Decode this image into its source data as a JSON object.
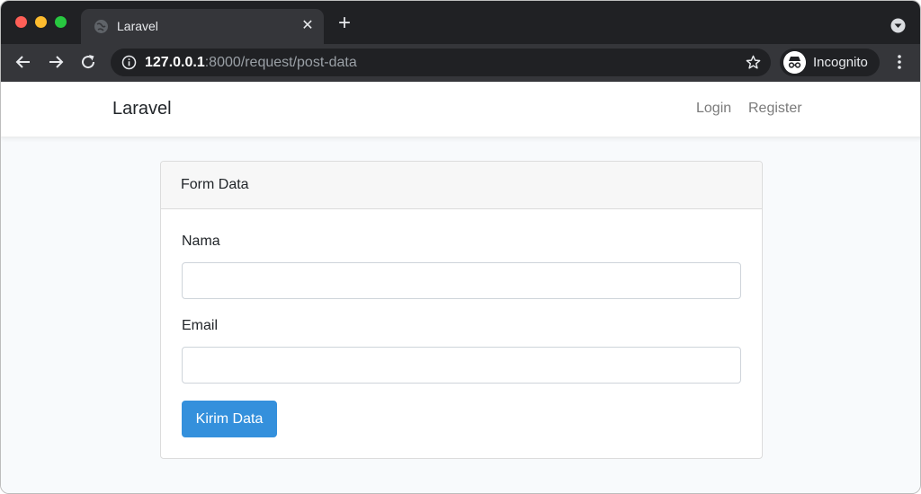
{
  "browser": {
    "tab_title": "Laravel",
    "url_host": "127.0.0.1",
    "url_path": ":8000/request/post-data",
    "profile_label": "Incognito",
    "icons": {
      "favicon": "globe-icon",
      "close": "close-icon",
      "new_tab": "plus-icon",
      "tab_search": "chevron-down-circle-icon",
      "back": "arrow-left-icon",
      "forward": "arrow-right-icon",
      "reload": "reload-icon",
      "info": "info-icon",
      "bookmark": "star-icon",
      "incognito": "incognito-icon",
      "menu": "kebab-menu-icon"
    }
  },
  "navbar": {
    "brand": "Laravel",
    "links": {
      "login": "Login",
      "register": "Register"
    }
  },
  "form_card": {
    "header": "Form Data",
    "fields": {
      "nama": {
        "label": "Nama",
        "value": "",
        "placeholder": ""
      },
      "email": {
        "label": "Email",
        "value": "",
        "placeholder": ""
      }
    },
    "submit_label": "Kirim Data"
  },
  "colors": {
    "primary": "#3490dc",
    "chrome_dark": "#202124",
    "chrome_tab": "#35363a",
    "page_bg": "#f8fafc"
  }
}
